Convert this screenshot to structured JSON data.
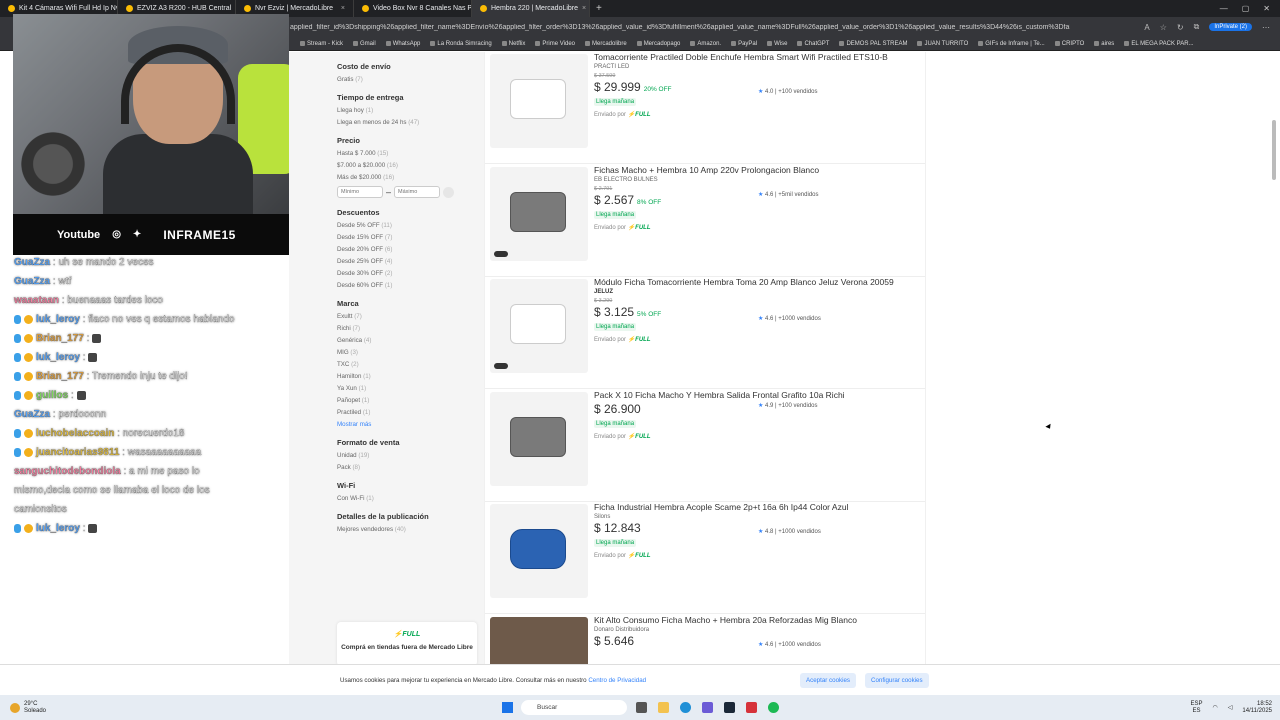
{
  "browser": {
    "tabs": [
      {
        "label": "Kit 4 Cámaras Wifi Full Hd Ip Nvr",
        "active": false
      },
      {
        "label": "EZVIZ A3 R200 - HUB Central",
        "active": false
      },
      {
        "label": "Nvr Ezviz | MercadoLibre",
        "active": false
      },
      {
        "label": "Video Box Nvr 8 Canales Nas Pa",
        "active": false
      },
      {
        "label": "Hembra 220 | MercadoLibre",
        "active": true
      }
    ],
    "url": "applied_filter_id%3Dshipping%26applied_filter_name%3DEnvío%26applied_filter_order%3D13%26applied_value_id%3Dfulfillment%26applied_value_name%3DFull%26applied_value_order%3D1%26applied_value_results%3D44%26is_custom%3Dfalse",
    "profile": "InPrivate (2)",
    "bookmarks": [
      "Stream - Kick",
      "Gmail",
      "WhatsApp",
      "La Ronda Simracing",
      "Netflix",
      "Prime Video",
      "Mercadolibre",
      "Mercadopago",
      "Amazon.",
      "PayPal",
      "Wise",
      "ChatGPT",
      "DEMOS PAL STREAM",
      "JUAN TURRITO",
      "GIFs de Inframe | Te...",
      "CRIPTO",
      "aires",
      "EL MEGA PACK PAR..."
    ]
  },
  "stream": {
    "youtube": "Youtube",
    "channel": "INFRAME15",
    "chat": [
      {
        "user": "GuaZza",
        "msg": ": uh se mando 2 veces",
        "color": "#4fa3ff",
        "badge": false
      },
      {
        "user": "GuaZza",
        "msg": ": wtf",
        "color": "#4fa3ff",
        "badge": false
      },
      {
        "user": "waaataan",
        "msg": ": buenaaas tardes loco",
        "color": "#ff7fa3",
        "badge": false
      },
      {
        "user": "luk_leroy",
        "msg": ": flaco no ves q estamos hablando",
        "color": "#4fa3ff",
        "badge": true
      },
      {
        "user": "Brian_177",
        "msg": ":",
        "color": "#e8a33a",
        "badge": true
      },
      {
        "user": "luk_leroy",
        "msg": ":",
        "color": "#4fa3ff",
        "badge": true
      },
      {
        "user": "Brian_177",
        "msg": ": Tremendo inju te dijo!",
        "color": "#e8a33a",
        "badge": true
      },
      {
        "user": "guillos",
        "msg": ":",
        "color": "#7fe35a",
        "badge": true
      },
      {
        "user": "GuaZza",
        "msg": ": perdooonn",
        "color": "#4fa3ff",
        "badge": false
      },
      {
        "user": "luchobelaccoain",
        "msg": ": norecuerdo18",
        "color": "#e8c13a",
        "badge": true
      },
      {
        "user": "juancitoarias9811",
        "msg": ": wasaaaaaaaaaa",
        "color": "#e8c13a",
        "badge": true
      },
      {
        "user": "sanguchitodebondiola",
        "msg": ": a mi me paso lo mismo,decia como se llamaba el loco de los camionsitos",
        "color": "#ff7fa3",
        "badge": false
      },
      {
        "user": "luk_leroy",
        "msg": ":",
        "color": "#4fa3ff",
        "badge": true
      }
    ]
  },
  "filters": {
    "groups": [
      {
        "title": "Costo de envío",
        "items": [
          {
            "label": "Gratis",
            "count": "(7)"
          }
        ]
      },
      {
        "title": "Tiempo de entrega",
        "items": [
          {
            "label": "Llega hoy",
            "count": "(1)"
          },
          {
            "label": "Llega en menos de 24 hs",
            "count": "(47)"
          }
        ]
      },
      {
        "title": "Precio",
        "items": [
          {
            "label": "Hasta $ 7.000",
            "count": "(15)"
          },
          {
            "label": "$7.000 a $20.000",
            "count": "(16)"
          },
          {
            "label": "Más de $20.000",
            "count": "(16)"
          }
        ]
      },
      {
        "title": "Descuentos",
        "items": [
          {
            "label": "Desde 5% OFF",
            "count": "(11)"
          },
          {
            "label": "Desde 15% OFF",
            "count": "(7)"
          },
          {
            "label": "Desde 20% OFF",
            "count": "(6)"
          },
          {
            "label": "Desde 25% OFF",
            "count": "(4)"
          },
          {
            "label": "Desde 30% OFF",
            "count": "(2)"
          },
          {
            "label": "Desde 60% OFF",
            "count": "(1)"
          }
        ]
      },
      {
        "title": "Marca",
        "items": [
          {
            "label": "Exultt",
            "count": "(7)"
          },
          {
            "label": "Richi",
            "count": "(7)"
          },
          {
            "label": "Genérica",
            "count": "(4)"
          },
          {
            "label": "MIG",
            "count": "(3)"
          },
          {
            "label": "TXC",
            "count": "(2)"
          },
          {
            "label": "Hamilton",
            "count": "(1)"
          },
          {
            "label": "Ya Xun",
            "count": "(1)"
          },
          {
            "label": "Pañopet",
            "count": "(1)"
          },
          {
            "label": "Practiled",
            "count": "(1)"
          }
        ],
        "more": "Mostrar más"
      },
      {
        "title": "Formato de venta",
        "items": [
          {
            "label": "Unidad",
            "count": "(19)"
          },
          {
            "label": "Pack",
            "count": "(8)"
          }
        ]
      },
      {
        "title": "Wi-Fi",
        "items": [
          {
            "label": "Con Wi-Fi",
            "count": "(1)"
          }
        ]
      },
      {
        "title": "Detalles de la publicación",
        "items": [
          {
            "label": "Mejores vendedores",
            "count": "(40)"
          }
        ]
      }
    ],
    "price_min_placeholder": "Mínimo",
    "price_max_placeholder": "Máximo",
    "full_card": {
      "logo": "⚡FULL",
      "text": "Comprá en tiendas fuera de Mercado Libre"
    }
  },
  "results": [
    {
      "title": "Tomacorriente Practiled Doble Enchufe Hembra Smart Wifi Practiled ETS10-B",
      "seller": "PRACTI LED",
      "orig": "$ 37.599",
      "price": "$ 29.999",
      "off": "20% OFF",
      "arrive": "Llega mañana",
      "sent": "Enviado por",
      "full": "⚡FULL",
      "rating": "4.0",
      "sold": "+100 vendidos",
      "thumb": "white"
    },
    {
      "title": "Fichas Macho + Hembra 10 Amp 220v Prolongacion Blanco",
      "seller": "EB ELECTRO BULNES",
      "orig": "$ 2.791",
      "price": "$ 2.567",
      "off": "8% OFF",
      "arrive": "Llega mañana",
      "sent": "Enviado por",
      "full": "⚡FULL",
      "rating": "4.6",
      "sold": "+5mil vendidos",
      "thumb": "dark"
    },
    {
      "title": "Módulo Ficha Tomacorriente Hembra Toma 20 Amp Blanco Jeluz Verona 20059",
      "seller": "JELUZ",
      "orig": "$ 3.290",
      "price": "$ 3.125",
      "off": "5% OFF",
      "arrive": "Llega mañana",
      "sent": "Enviado por",
      "full": "⚡FULL",
      "rating": "4.6",
      "sold": "+1000 vendidos",
      "thumb": "white"
    },
    {
      "title": "Pack X 10 Ficha Macho Y Hembra Salida Frontal Grafito 10a Richi",
      "seller": "",
      "orig": "",
      "price": "$ 26.900",
      "off": "",
      "arrive": "Llega mañana",
      "sent": "Enviado por",
      "full": "⚡FULL",
      "rating": "4.9",
      "sold": "+100 vendidos",
      "thumb": "dark"
    },
    {
      "title": "Ficha Industrial Hembra Acople Scame 2p+t 16a 6h Ip44 Color Azul",
      "seller": "Silons",
      "orig": "",
      "price": "$ 12.843",
      "off": "",
      "arrive": "Llega mañana",
      "sent": "Enviado por",
      "full": "⚡FULL",
      "rating": "4.8",
      "sold": "+1000 vendidos",
      "thumb": "blue"
    },
    {
      "title": "Kit Alto Consumo Ficha Macho + Hembra 20a Reforzadas Mig Blanco",
      "seller": "Donaro Distribuidora",
      "orig": "",
      "price": "$ 5.646",
      "off": "",
      "arrive": "",
      "sent": "",
      "full": "",
      "rating": "4.6",
      "sold": "+1000 vendidos",
      "thumb": "photo"
    }
  ],
  "cookies": {
    "text": "Usamos cookies para mejorar tu experiencia en Mercado Libre. Consultar más en nuestro",
    "link": "Centro de Privacidad",
    "accept": "Aceptar cookies",
    "configure": "Configurar cookies"
  },
  "taskbar": {
    "temp": "29°C",
    "weather": "Soleado",
    "search": "Buscar",
    "lang": "ESP",
    "region": "ES",
    "time": "18:52",
    "date": "14/11/2025"
  }
}
